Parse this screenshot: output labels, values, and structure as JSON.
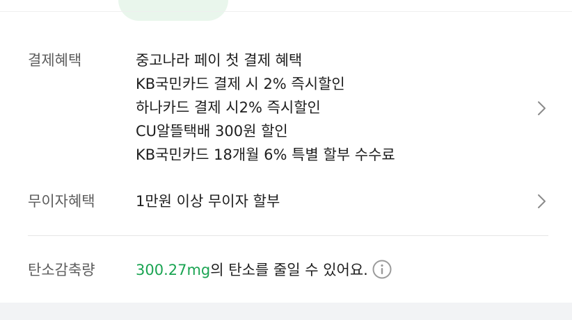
{
  "payment_benefits": {
    "label": "결제혜택",
    "items": [
      "중고나라 페이 첫 결제 혜택",
      "KB국민카드 결제 시 2% 즉시할인",
      "하나카드 결제 시2% 즉시할인",
      "CU알뜰택배 300원 할인",
      "KB국민카드 18개월 6% 특별 할부 수수료"
    ]
  },
  "installment_benefits": {
    "label": "무이자혜택",
    "text": "1만원 이상 무이자 할부"
  },
  "carbon": {
    "label": "탄소감축량",
    "amount": "300.27mg",
    "suffix": "의 탄소를 줄일 수 있어요."
  },
  "icons": {
    "chevron": "chevron-right-icon",
    "info": "info-icon"
  },
  "colors": {
    "accent_green": "#1aa452",
    "pill_bg": "#e9f6ec",
    "bottom_band": "#f2f3f5"
  }
}
